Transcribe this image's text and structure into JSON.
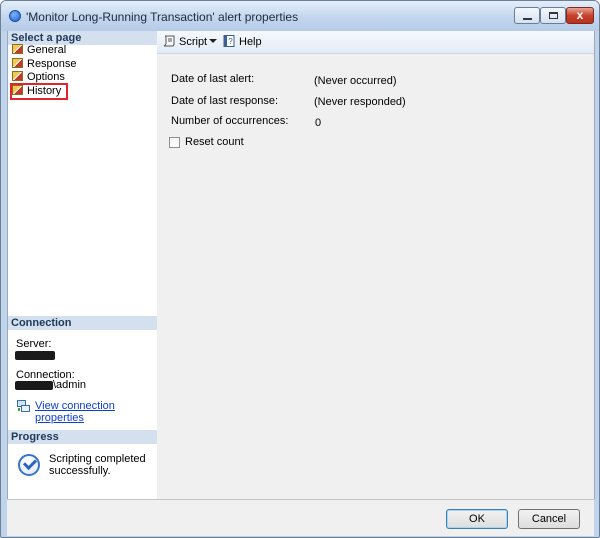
{
  "window": {
    "title": "'Monitor Long-Running Transaction' alert properties",
    "close_glyph": "x"
  },
  "sidebar": {
    "header": "Select a page",
    "items": [
      {
        "label": "General"
      },
      {
        "label": "Response"
      },
      {
        "label": "Options"
      },
      {
        "label": "History",
        "selected": true
      }
    ]
  },
  "connection": {
    "header": "Connection",
    "server_label": "Server:",
    "connection_label": "Connection:",
    "connection_suffix": "\\admin",
    "view_link": "View connection properties"
  },
  "progress": {
    "header": "Progress",
    "status": "Scripting completed successfully."
  },
  "toolbar": {
    "script_label": "Script",
    "help_label": "Help"
  },
  "history": {
    "last_alert_label": "Date of last alert:",
    "last_alert_value": "(Never occurred)",
    "last_response_label": "Date of last response:",
    "last_response_value": "(Never responded)",
    "occurrences_label": "Number of occurrences:",
    "occurrences_value": "0",
    "reset_label": "Reset count"
  },
  "footer": {
    "ok_label": "OK",
    "cancel_label": "Cancel"
  },
  "colors": {
    "highlight_box": "#e0262c",
    "section_header": "#d4e0ee",
    "link": "#0b3fd1"
  }
}
